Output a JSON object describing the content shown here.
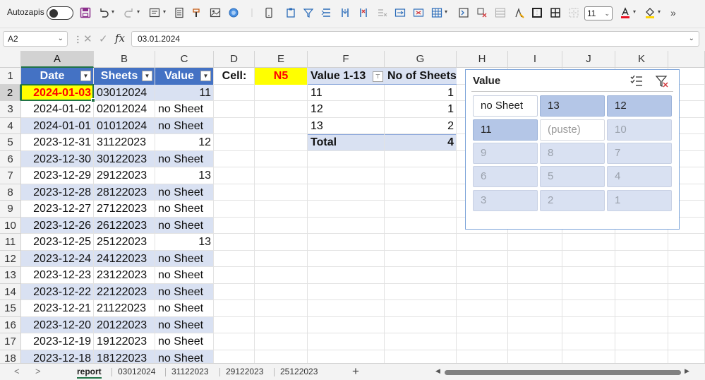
{
  "toolbar": {
    "autosave_label": "Autozapis",
    "font_size": "11",
    "more_label": "»",
    "font_color": "#e81123",
    "fill_color": "#ffd500"
  },
  "formula_bar": {
    "name_box": "A2",
    "formula": "03.01.2024"
  },
  "columns": [
    "A",
    "B",
    "C",
    "D",
    "E",
    "F",
    "G",
    "H",
    "I",
    "J",
    "K"
  ],
  "rows": [
    "1",
    "2",
    "3",
    "4",
    "5",
    "6",
    "7",
    "8",
    "9",
    "10",
    "11",
    "12",
    "13",
    "14",
    "15",
    "16",
    "17",
    "18"
  ],
  "table": {
    "headers": [
      "Date",
      "Sheets",
      "Value"
    ],
    "rows": [
      [
        "2024-01-03",
        "03012024",
        "11"
      ],
      [
        "2024-01-02",
        "02012024",
        "no Sheet"
      ],
      [
        "2024-01-01",
        "01012024",
        "no Sheet"
      ],
      [
        "2023-12-31",
        "31122023",
        "12"
      ],
      [
        "2023-12-30",
        "30122023",
        "no Sheet"
      ],
      [
        "2023-12-29",
        "29122023",
        "13"
      ],
      [
        "2023-12-28",
        "28122023",
        "no Sheet"
      ],
      [
        "2023-12-27",
        "27122023",
        "no Sheet"
      ],
      [
        "2023-12-26",
        "26122023",
        "no Sheet"
      ],
      [
        "2023-12-25",
        "25122023",
        "13"
      ],
      [
        "2023-12-24",
        "24122023",
        "no Sheet"
      ],
      [
        "2023-12-23",
        "23122023",
        "no Sheet"
      ],
      [
        "2023-12-22",
        "22122023",
        "no Sheet"
      ],
      [
        "2023-12-21",
        "21122023",
        "no Sheet"
      ],
      [
        "2023-12-20",
        "20122023",
        "no Sheet"
      ],
      [
        "2023-12-19",
        "19122023",
        "no Sheet"
      ],
      [
        "2023-12-18",
        "18122023",
        "no Sheet"
      ]
    ]
  },
  "cell_label": {
    "label": "Cell:",
    "value": "N5"
  },
  "pivot": {
    "headers": [
      "Value 1-13",
      "No of Sheets"
    ],
    "rows": [
      [
        "11",
        "1"
      ],
      [
        "12",
        "1"
      ],
      [
        "13",
        "2"
      ]
    ],
    "total_label": "Total",
    "total_value": "4"
  },
  "slicer": {
    "title": "Value",
    "buttons": [
      {
        "label": "no Sheet",
        "state": "avail"
      },
      {
        "label": "13",
        "state": "sel"
      },
      {
        "label": "12",
        "state": "sel"
      },
      {
        "label": "11",
        "state": "sel"
      },
      {
        "label": "(puste)",
        "state": "nodata-avail"
      },
      {
        "label": "10",
        "state": "nodata"
      },
      {
        "label": "9",
        "state": "nodata"
      },
      {
        "label": "8",
        "state": "nodata"
      },
      {
        "label": "7",
        "state": "nodata"
      },
      {
        "label": "6",
        "state": "nodata"
      },
      {
        "label": "5",
        "state": "nodata"
      },
      {
        "label": "4",
        "state": "nodata"
      },
      {
        "label": "3",
        "state": "nodata"
      },
      {
        "label": "2",
        "state": "nodata"
      },
      {
        "label": "1",
        "state": "nodata"
      }
    ]
  },
  "sheet_tabs": {
    "items": [
      "report",
      "03012024",
      "31122023",
      "29122023",
      "25122023"
    ],
    "active": "report"
  },
  "colors": {
    "header_blue": "#4472c4",
    "band_light": "#d9e1f2",
    "highlight_yellow": "#ffff00",
    "highlight_red_text": "#ff0000",
    "excel_green": "#217346"
  }
}
